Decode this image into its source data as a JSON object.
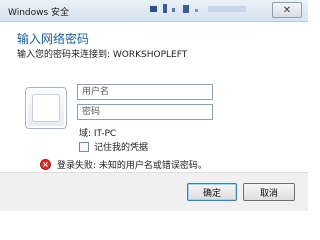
{
  "window": {
    "title": "Windows 安全",
    "close_glyph": "✕"
  },
  "dialog": {
    "heading": "输入网络密码",
    "subheading": "输入您的密码来连接到: WORKSHOPLEFT"
  },
  "credentials": {
    "username_placeholder": "用户名",
    "password_placeholder": "密码",
    "domain_text": "域: IT-PC",
    "remember_label": "记住我的凭据",
    "remember_checked": false
  },
  "error": {
    "icon": "error-x-icon",
    "glyph": "×",
    "message": "登录失败: 未知的用户名或错误密码。",
    "color": "#d9302b"
  },
  "buttons": {
    "ok_label": "确定",
    "cancel_label": "取消"
  }
}
